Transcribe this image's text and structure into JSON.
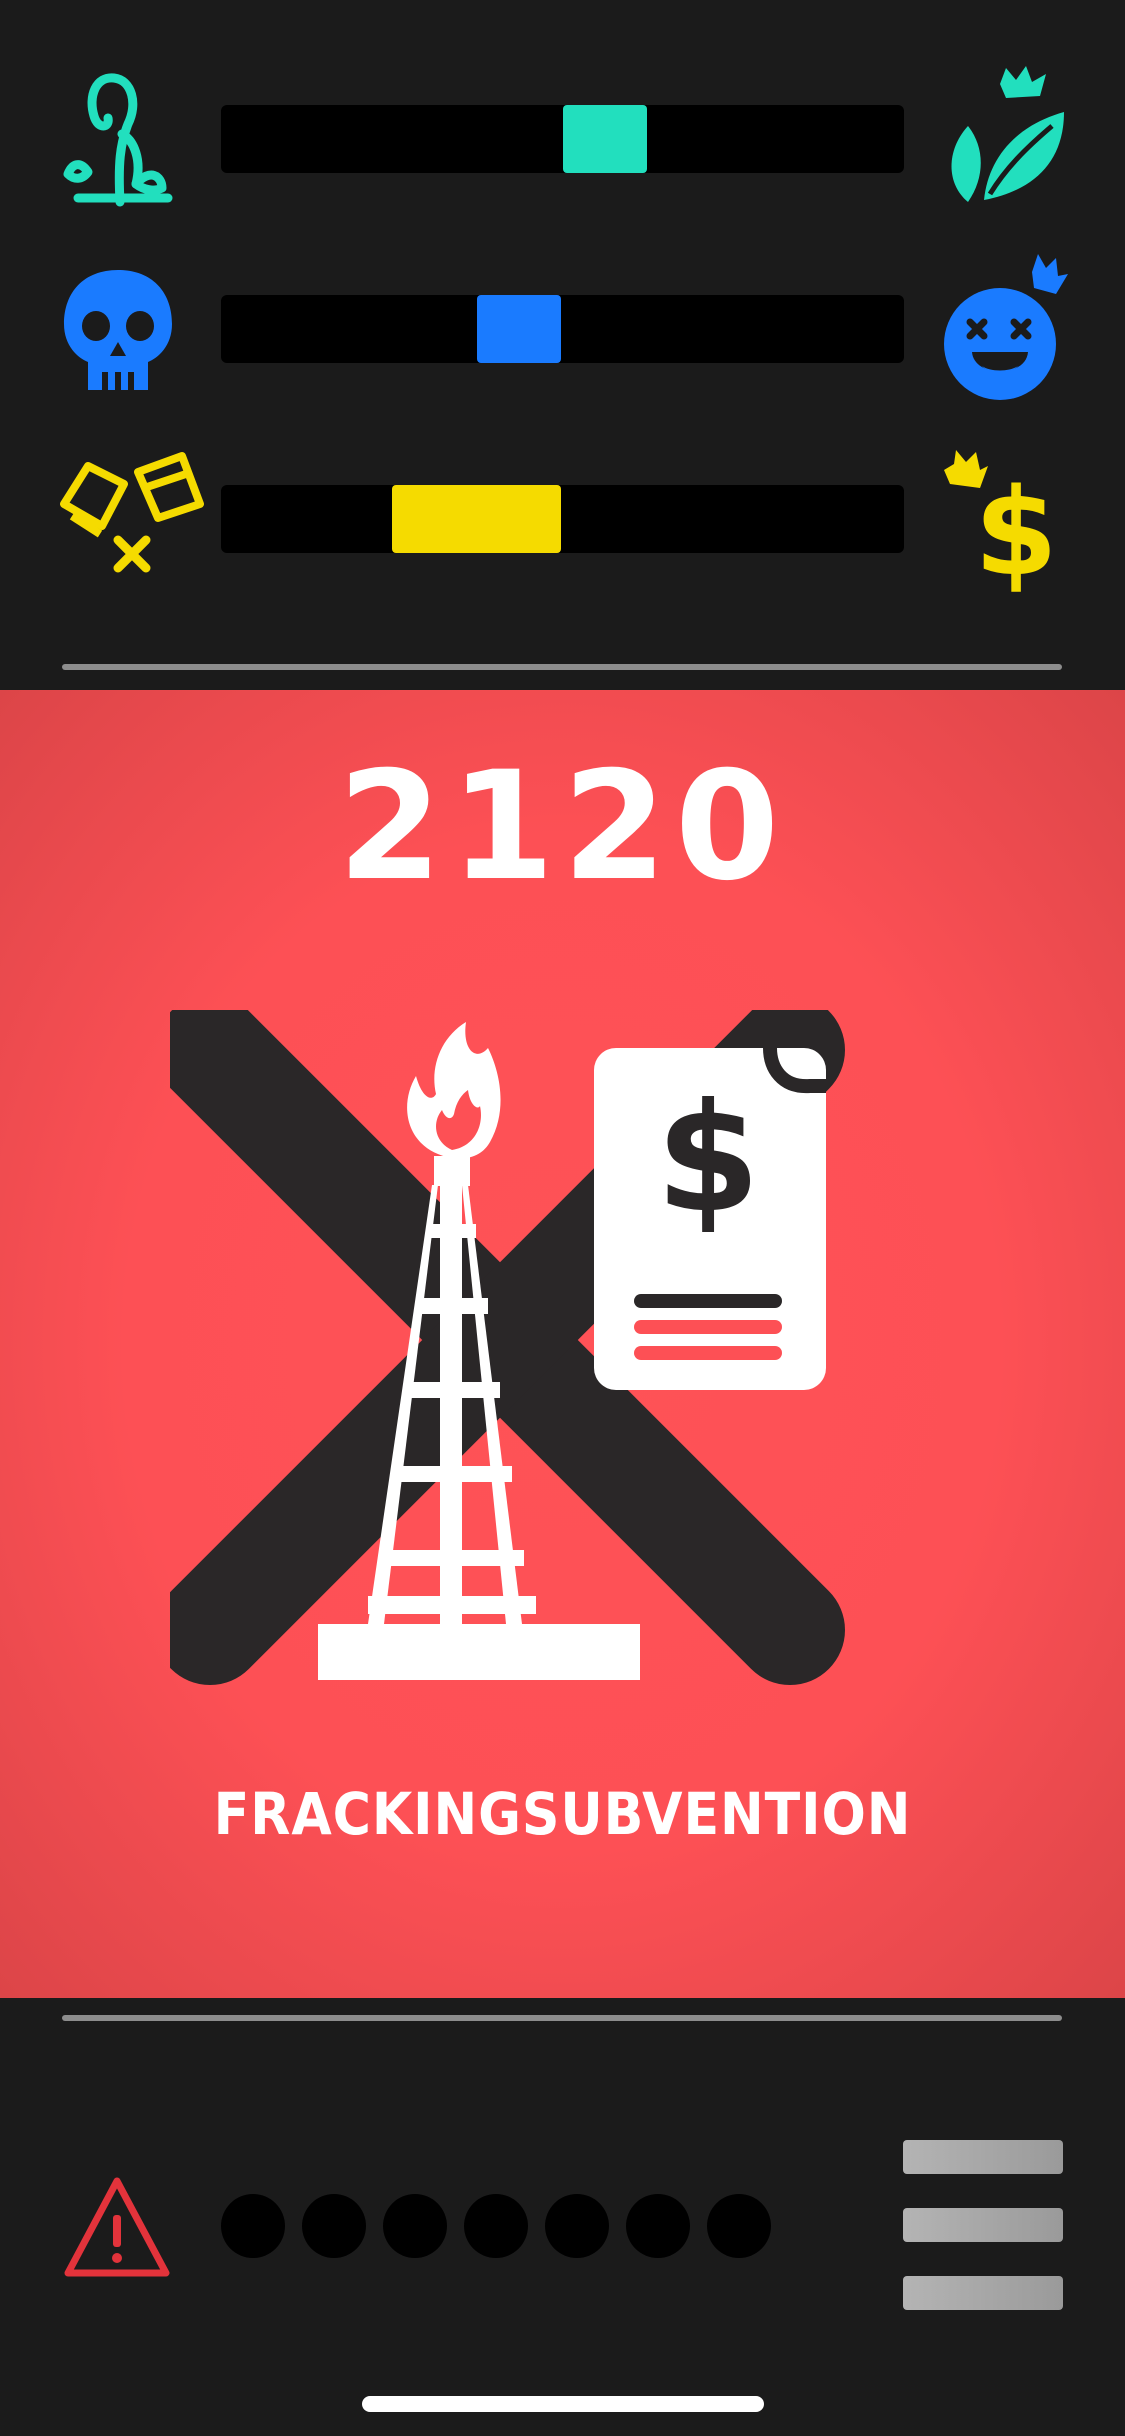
{
  "meters": [
    {
      "name": "environment",
      "left_icon": "sprout-dying-icon",
      "right_icon": "leaves-crown-icon",
      "color": "#22dfbe",
      "value_start": 0.5,
      "value_end": 0.625
    },
    {
      "name": "people",
      "left_icon": "skull-icon",
      "right_icon": "laughing-face-crown-icon",
      "color": "#1a7bff",
      "value_start": 0.375,
      "value_end": 0.5
    },
    {
      "name": "economy",
      "left_icon": "broken-money-icon",
      "right_icon": "dollar-crown-icon",
      "color": "#f5db00",
      "value_start": 0.25,
      "value_end": 0.5
    }
  ],
  "card": {
    "year": "2120",
    "title": "FRACKINGSUBVENTION",
    "background": "#fd5055",
    "icon": "fracking-rig-subsidy-crossed-icon"
  },
  "bottom": {
    "warning_icon": "warning-triangle-icon",
    "warning_color": "#e3333b",
    "progress_dots": [
      0,
      0,
      0,
      0,
      0,
      0,
      0
    ],
    "menu_icon": "hamburger-menu-icon"
  }
}
